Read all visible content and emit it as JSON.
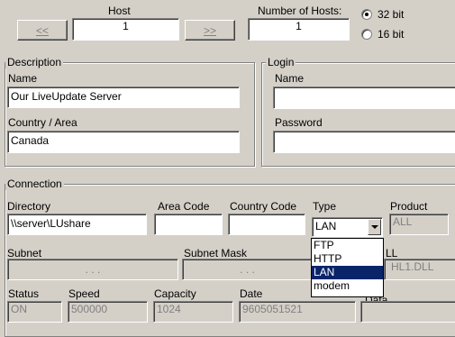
{
  "host": {
    "label": "Host",
    "value": "1",
    "prev_label": "<<",
    "next_label": ">>"
  },
  "num_hosts": {
    "label": "Number of Hosts:",
    "value": "1"
  },
  "bitness": {
    "opt32": "32 bit",
    "opt16": "16 bit",
    "selected": "32 bit"
  },
  "description": {
    "group_label": "Description",
    "name_label": "Name",
    "name_value": "Our LiveUpdate Server",
    "country_label": "Country / Area",
    "country_value": "Canada"
  },
  "login": {
    "group_label": "Login",
    "name_label": "Name",
    "name_value": "",
    "password_label": "Password",
    "password_value": ""
  },
  "connection": {
    "group_label": "Connection",
    "directory_label": "Directory",
    "directory_value": "\\\\server\\LUshare",
    "area_code_label": "Area Code",
    "area_code_value": "",
    "country_code_label": "Country Code",
    "country_code_value": "",
    "type_label": "Type",
    "type_value": "LAN",
    "type_options": [
      "FTP",
      "HTTP",
      "LAN",
      "modem"
    ],
    "product_label": "Product",
    "product_value": "ALL",
    "subnet_label": "Subnet",
    "subnet_value": ".   .   .",
    "subnet_mask_label": "Subnet Mask",
    "subnet_mask_value": ".   .   .",
    "dll_label": "LL",
    "dll_value": "HL1.DLL",
    "status_label": "Status",
    "status_value": "ON",
    "speed_label": "Speed",
    "speed_value": "500000",
    "capacity_label": "Capacity",
    "capacity_value": "1024",
    "date_label": "Date",
    "date_value": "9605051521",
    "data_label": "Data"
  }
}
